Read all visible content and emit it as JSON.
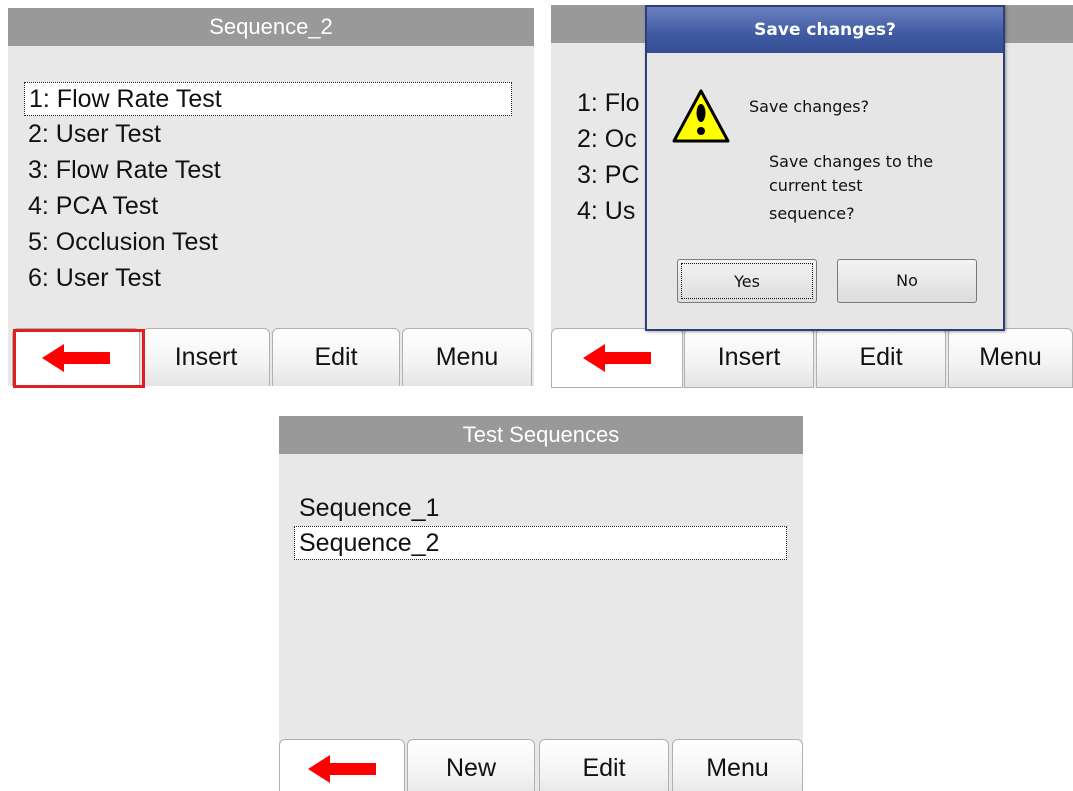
{
  "screen1": {
    "title": "Sequence_2",
    "items": [
      "1: Flow Rate Test",
      "2: User Test",
      "3: Flow Rate Test",
      "4: PCA Test",
      "5: Occlusion Test",
      "6: User Test"
    ],
    "buttons": {
      "insert": "Insert",
      "edit": "Edit",
      "menu": "Menu"
    },
    "back_icon": "left-arrow-icon",
    "highlight_color": "#e02020"
  },
  "screen2": {
    "items_partial": [
      "1: Flo",
      "2: Oc",
      "3: PC",
      "4: Us"
    ],
    "buttons": {
      "insert": "Insert",
      "edit": "Edit",
      "menu": "Menu"
    },
    "back_icon": "left-arrow-icon",
    "dialog": {
      "title": "Save changes?",
      "heading": "Save changes?",
      "message_line1": "Save changes to the",
      "message_line2": "current test",
      "message_line3": "sequence?",
      "yes": "Yes",
      "no": "No",
      "icon": "warning-icon"
    }
  },
  "screen3": {
    "title": "Test Sequences",
    "items": [
      "Sequence_1",
      "Sequence_2"
    ],
    "buttons": {
      "new": "New",
      "edit": "Edit",
      "menu": "Menu"
    },
    "back_icon": "left-arrow-icon"
  },
  "colors": {
    "titlebar": "#999999",
    "screen_bg": "#e8e8e8",
    "arrow": "#ff0000",
    "dialog_title": "#3f5aa3",
    "warning": "#ffff00"
  }
}
